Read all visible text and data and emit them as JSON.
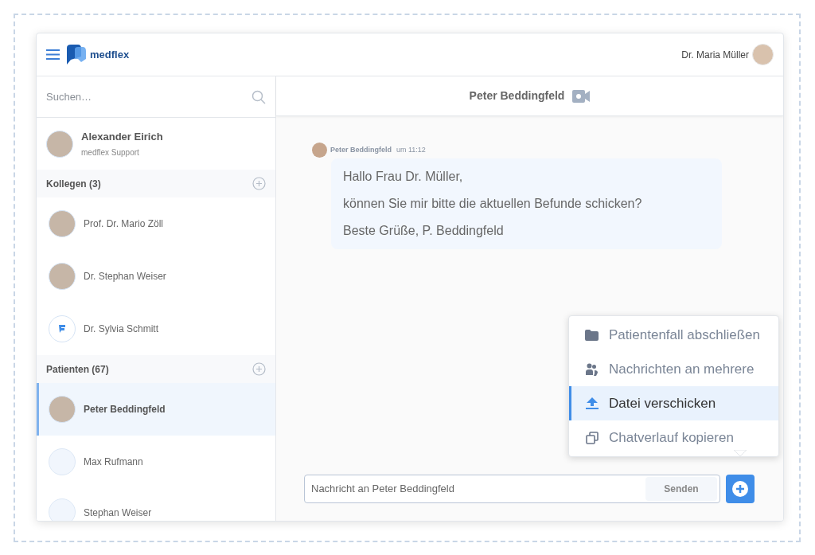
{
  "header": {
    "brand": "medflex",
    "user_name": "Dr. Maria Müller"
  },
  "search": {
    "placeholder": "Suchen…"
  },
  "support_contact": {
    "name": "Alexander Eirich",
    "subtitle": "medflex Support",
    "kind": "photo"
  },
  "sections": [
    {
      "title": "Kollegen (3)",
      "contacts": [
        {
          "name": "Prof. Dr. Mario Zöll",
          "kind": "photo",
          "selected": false
        },
        {
          "name": "Dr. Stephan Weiser",
          "kind": "photo",
          "selected": false
        },
        {
          "name": "Dr. Sylvia Schmitt",
          "kind": "logo",
          "selected": false
        }
      ]
    },
    {
      "title": "Patienten (67)",
      "contacts": [
        {
          "name": "Peter Beddingfeld",
          "kind": "photo",
          "selected": true
        },
        {
          "name": "Max Rufmann",
          "kind": "empty",
          "selected": false
        },
        {
          "name": "Stephan Weiser",
          "kind": "empty",
          "selected": false
        }
      ]
    }
  ],
  "chat": {
    "title": "Peter Beddingfeld",
    "messages": [
      {
        "sender": "Peter Beddingfeld",
        "time": "um 11:12",
        "lines": [
          "Hallo Frau Dr. Müller,",
          "können Sie mir bitte die aktuellen Befunde schicken?",
          "Beste Grüße, P. Beddingfeld"
        ]
      }
    ]
  },
  "menu": {
    "items": [
      {
        "label": "Patientenfall abschließen",
        "kind": "folder",
        "selected": false
      },
      {
        "label": "Nachrichten an mehrere",
        "kind": "group",
        "selected": false
      },
      {
        "label": "Datei verschicken",
        "kind": "upload",
        "selected": true
      },
      {
        "label": "Chatverlauf kopieren",
        "kind": "copy",
        "selected": false
      }
    ]
  },
  "composer": {
    "placeholder": "Nachricht an Peter Beddingfeld",
    "send_label": "Senden"
  }
}
